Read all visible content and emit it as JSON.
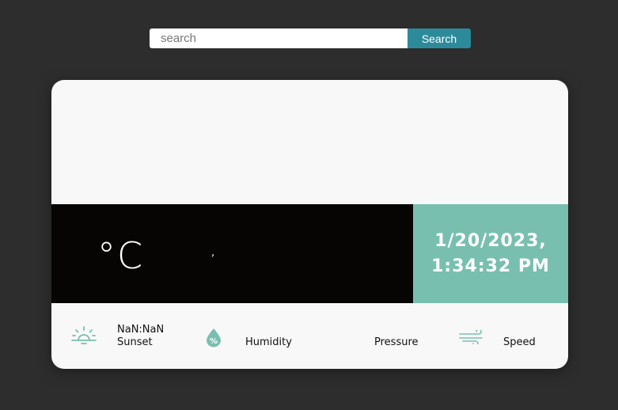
{
  "search": {
    "placeholder": "search",
    "value": "",
    "button_label": "Search"
  },
  "weather": {
    "temperature_unit": "°C",
    "location_text": ",",
    "date": "1/20/2023,",
    "time": "1:34:32 PM"
  },
  "stats": {
    "sunset": {
      "icon": "sunset-icon",
      "value": "NaN:NaN",
      "label": "Sunset"
    },
    "humidity": {
      "icon": "humidity-icon",
      "label": "Humidity"
    },
    "pressure": {
      "label": "Pressure"
    },
    "speed": {
      "icon": "wind-icon",
      "label": "Speed"
    }
  },
  "colors": {
    "background": "#2d2d2d",
    "accent": "#2d8a9b",
    "teal_panel": "#79bfb0",
    "dark_band": "#060504"
  }
}
